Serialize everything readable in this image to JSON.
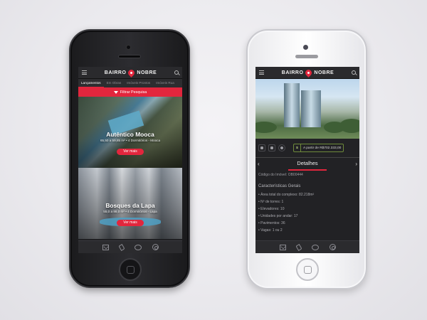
{
  "brand": {
    "logo_left": "BAIRRO",
    "logo_right": "NOBRE",
    "accent": "#e2263d"
  },
  "left_phone": {
    "tabs": [
      "Lançamentos",
      "Em Obras",
      "Imóveis Prontos",
      "Imóveis Rua"
    ],
    "filter_label": "Filtrar Pesquisa",
    "cards": [
      {
        "title": "Autêntico Mooca",
        "subtitle": "65,50 a 59,85 m² • 4 Dormitórios - Mooca",
        "button": "Ver mais"
      },
      {
        "title": "Bosques da Lapa",
        "subtitle": "55,0 a 86,0 m² • 4 Dormitórios - Lapa",
        "button": "Ver mais"
      }
    ],
    "bottom_icons": [
      "mail-icon",
      "phone-icon",
      "chat-icon",
      "whatsapp-icon"
    ]
  },
  "right_phone": {
    "price_label": "A partir de R$702.333,00",
    "section_title": "Detalhes",
    "code": "Código do Imóvel: OB00444",
    "features_title": "Características Gerais",
    "features": [
      "Área total do complexo: 82.218m²",
      "Nº de torres: 1",
      "Elevadores: 10",
      "Unidades por andar: 17",
      "Pavimentos: 36",
      "Vagas: 1 ou 2"
    ],
    "bottom_icons": [
      "mail-icon",
      "phone-icon",
      "chat-icon",
      "whatsapp-icon"
    ]
  }
}
